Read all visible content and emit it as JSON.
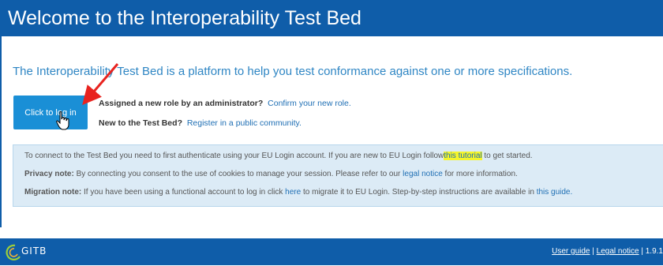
{
  "header": {
    "title": "Welcome to the Interoperability Test Bed"
  },
  "intro": {
    "text": "The Interoperability Test Bed is a platform to help you test conformance against one or more specifications."
  },
  "login": {
    "button_label": "Click to log in"
  },
  "role": {
    "question": "Assigned a new role by an administrator?",
    "link": "Confirm your new role."
  },
  "newuser": {
    "question": "New to the Test Bed?",
    "link": "Register in a public community."
  },
  "info": {
    "line1_before": "To connect to the Test Bed you need to first authenticate using your EU Login account. If you are new to EU Login follow",
    "line1_link": "this tutorial",
    "line1_after": "to get started.",
    "privacy_label": "Privacy note:",
    "privacy_before": "By connecting you consent to the use of cookies to manage your session. Please refer to our",
    "privacy_link": "legal notice",
    "privacy_after": "for more information.",
    "migration_label": "Migration note:",
    "migration_before": "If you have been using a functional account to log in click",
    "migration_link1": "here",
    "migration_middle": "to migrate it to EU Login. Step-by-step instructions are available in",
    "migration_link2": "this guide."
  },
  "footer": {
    "logo_text": "GITB",
    "user_guide": "User guide",
    "legal_notice": "Legal notice",
    "separator": "|",
    "version": "1.9.1"
  },
  "colors": {
    "brand": "#0f5da9",
    "button": "#1a8fd6",
    "info_bg": "#dcebf6",
    "highlight": "#f5f52a",
    "arrow": "#e8231f"
  }
}
